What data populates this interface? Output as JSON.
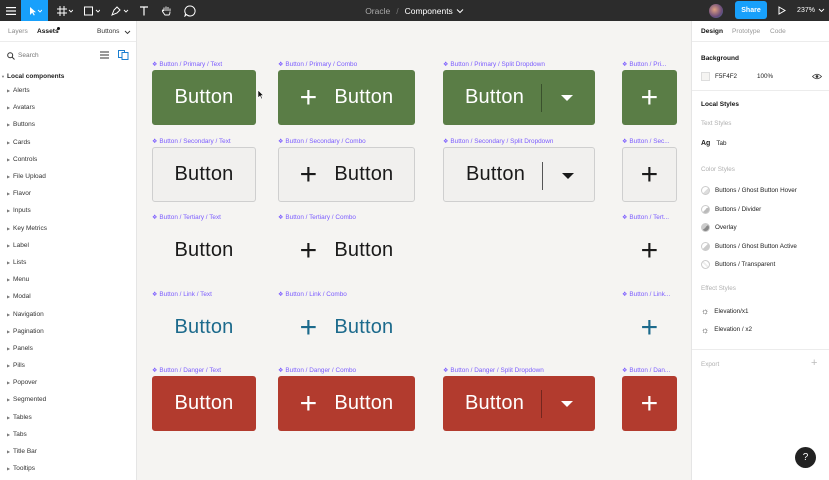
{
  "toolbar": {
    "project": "Oracle",
    "separator": "/",
    "file": "Components",
    "share_label": "Share",
    "zoom": "237%"
  },
  "left_panel": {
    "tabs": [
      "Layers",
      "Assets",
      "Buttons"
    ],
    "search_placeholder": "Search",
    "section_title": "Local components",
    "items": [
      "Alerts",
      "Avatars",
      "Buttons",
      "Cards",
      "Controls",
      "File Upload",
      "Flavor",
      "Inputs",
      "Key Metrics",
      "Label",
      "Lists",
      "Menu",
      "Modal",
      "Navigation",
      "Pagination",
      "Panels",
      "Pills",
      "Popover",
      "Segmented",
      "Tables",
      "Tabs",
      "Title Bar",
      "Tooltips"
    ]
  },
  "right_panel": {
    "tabs": [
      "Design",
      "Prototype",
      "Code"
    ],
    "background_title": "Background",
    "background_hex": "F5F4F2",
    "background_opacity": "100%",
    "local_styles_title": "Local Styles",
    "text_styles_title": "Text Styles",
    "text_style_item": "Tab",
    "color_styles_title": "Color Styles",
    "color_styles": [
      "Buttons / Ghost Button Hover",
      "Buttons / Divider",
      "Overlay",
      "Buttons / Ghost Button Active",
      "Buttons / Transparent"
    ],
    "effect_styles_title": "Effect Styles",
    "effect_styles": [
      "Elevation/x1",
      "Elevation / x2"
    ],
    "export_title": "Export"
  },
  "canvas": {
    "button_text": "Button",
    "rows": [
      {
        "variant": "primary",
        "labels": [
          "Button / Primary / Text",
          "Button / Primary / Combo",
          "Button / Primary / Split Dropdown",
          "Button / Pri..."
        ]
      },
      {
        "variant": "secondary",
        "labels": [
          "Button / Secondary / Text",
          "Button / Secondary / Combo",
          "Button / Secondary / Split Dropdown",
          "Button / Sec..."
        ]
      },
      {
        "variant": "tertiary",
        "labels": [
          "Button / Tertiary / Text",
          "Button / Tertiary / Combo",
          "",
          "Button / Tert..."
        ]
      },
      {
        "variant": "link",
        "labels": [
          "Button / Link / Text",
          "Button / Link / Combo",
          "",
          "Button / Link..."
        ]
      },
      {
        "variant": "danger",
        "labels": [
          "Button / Danger / Text",
          "Button / Danger / Combo",
          "Button / Danger / Split Dropdown",
          "Button / Dan..."
        ]
      }
    ]
  },
  "colors": {
    "toolbar_bg": "#2c2c2c",
    "accent": "#18a0fb",
    "primary": "#5a7d46",
    "secondary_bg": "#f1f0ee",
    "secondary_border": "#cfcfcf",
    "link": "#1c6a8c",
    "danger": "#b23b2e",
    "label": "#7b5cff"
  },
  "help_label": "?"
}
